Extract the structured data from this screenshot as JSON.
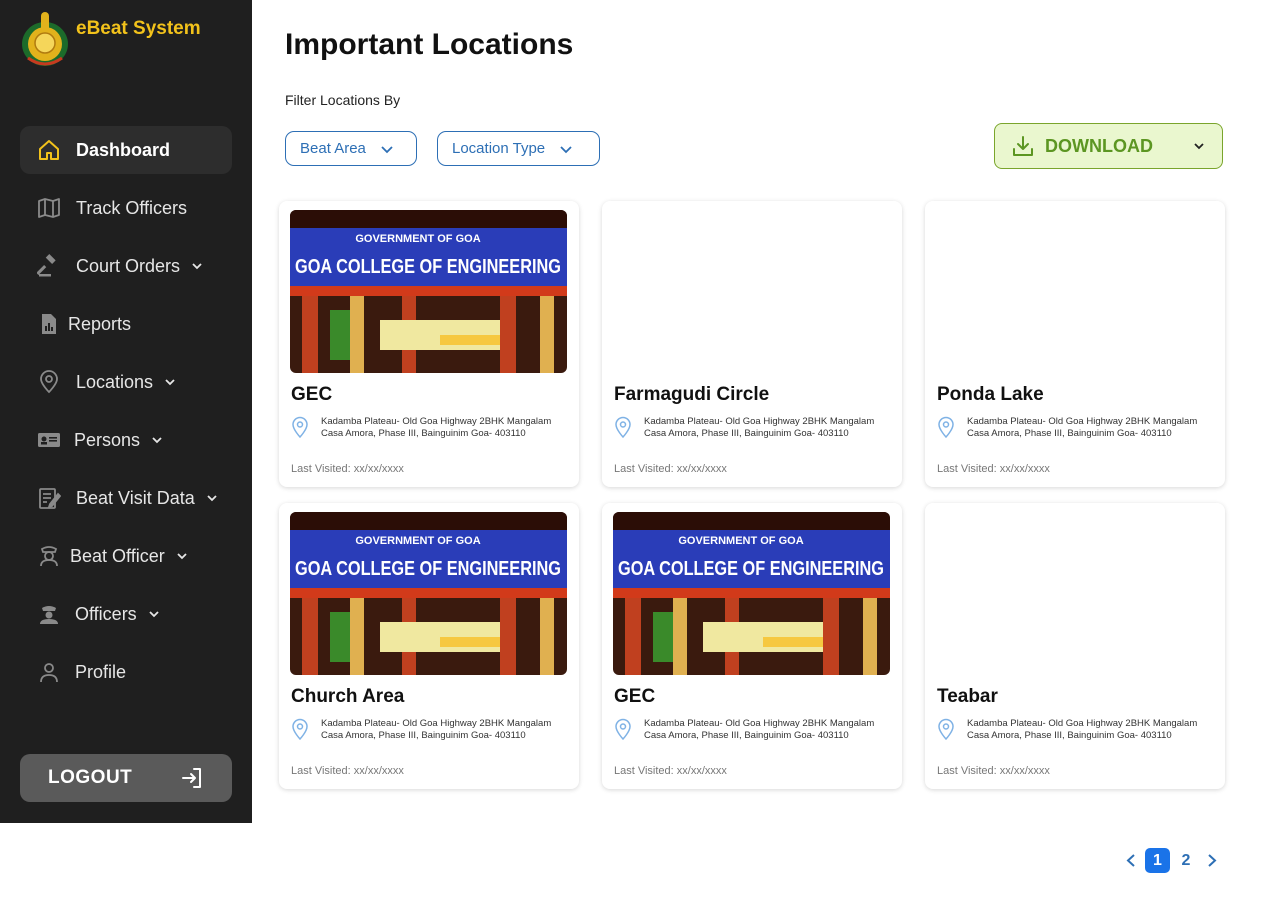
{
  "brand": {
    "title": "eBeat System"
  },
  "sidebar": {
    "items": [
      {
        "label": "Dashboard",
        "icon": "home-icon"
      },
      {
        "label": "Track Officers",
        "icon": "map-icon"
      },
      {
        "label": "Court Orders",
        "icon": "gavel-icon"
      },
      {
        "label": "Reports",
        "icon": "report-icon"
      },
      {
        "label": "Locations",
        "icon": "location-pin-icon"
      },
      {
        "label": "Persons",
        "icon": "id-card-icon"
      },
      {
        "label": "Beat Visit Data",
        "icon": "notepad-icon"
      },
      {
        "label": "Beat Officer",
        "icon": "officer-icon"
      },
      {
        "label": "Officers",
        "icon": "police-icon"
      },
      {
        "label": "Profile",
        "icon": "user-icon"
      }
    ],
    "logout_label": "LOGOUT"
  },
  "main": {
    "title": "Important Locations",
    "filter_label": "Filter Locations By",
    "filters": [
      "Beat Area",
      "Location Type"
    ],
    "download_label": "DOWNLOAD"
  },
  "cards": [
    {
      "title": "GEC",
      "address": "Kadamba Plateau- Old Goa Highway 2BHK Mangalam Casa Amora, Phase III, Bainguinim Goa- 403110",
      "last_visited": "Last Visited:  xx/xx/xxxx",
      "image_sign_top": "GOVERNMENT  OF  GOA",
      "image_sign_main": "GOA COLLEGE OF ENGINEERING"
    },
    {
      "title": "Farmagudi Circle",
      "address": "Kadamba Plateau- Old Goa Highway 2BHK Mangalam Casa Amora, Phase III, Bainguinim Goa- 403110",
      "last_visited": "Last Visited:  xx/xx/xxxx"
    },
    {
      "title": "Ponda Lake",
      "address": "Kadamba Plateau- Old Goa Highway 2BHK Mangalam Casa Amora, Phase III, Bainguinim Goa- 403110",
      "last_visited": "Last Visited:  xx/xx/xxxx"
    },
    {
      "title": "Church Area",
      "address": "Kadamba Plateau- Old Goa Highway 2BHK Mangalam Casa Amora, Phase III, Bainguinim Goa- 403110",
      "last_visited": "Last Visited:  xx/xx/xxxx",
      "image_sign_top": "GOVERNMENT  OF  GOA",
      "image_sign_main": "GOA COLLEGE OF ENGINEERING"
    },
    {
      "title": "GEC",
      "address": "Kadamba Plateau- Old Goa Highway 2BHK Mangalam Casa Amora, Phase III, Bainguinim Goa- 403110",
      "last_visited": "Last Visited:  xx/xx/xxxx",
      "image_sign_top": "GOVERNMENT  OF  GOA",
      "image_sign_main": "GOA COLLEGE OF ENGINEERING"
    },
    {
      "title": "Teabar",
      "address": "Kadamba Plateau- Old Goa Highway 2BHK Mangalam Casa Amora, Phase III, Bainguinim Goa- 403110",
      "last_visited": "Last Visited:  xx/xx/xxxx"
    }
  ],
  "pagination": {
    "pages": [
      "1",
      "2"
    ],
    "current": "1"
  },
  "colors": {
    "sidebar_bg": "#1f1f1f",
    "brand_yellow": "#f2c21b",
    "accent_blue": "#2d6fb5",
    "download_green": "#5c9622"
  }
}
